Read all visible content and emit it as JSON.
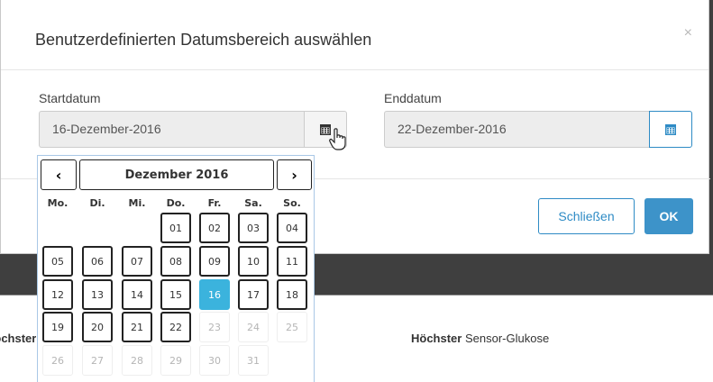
{
  "modal": {
    "title": "Benutzerdefinierten Datumsbereich auswählen",
    "close": "×",
    "start_label": "Startdatum",
    "start_value": "16-Dezember-2016",
    "end_label": "Enddatum",
    "end_value": "22-Dezember-2016",
    "close_button": "Schließen",
    "ok_button": "OK"
  },
  "datepicker": {
    "prev": "‹",
    "month": "Dezember 2016",
    "next": "›",
    "weekdays": [
      "Mo.",
      "Di.",
      "Mi.",
      "Do.",
      "Fr.",
      "Sa.",
      "So."
    ],
    "selected": "16",
    "rows": [
      [
        "",
        "",
        "",
        "01",
        "02",
        "03",
        "04"
      ],
      [
        "05",
        "06",
        "07",
        "08",
        "09",
        "10",
        "11"
      ],
      [
        "12",
        "13",
        "14",
        "15",
        "16",
        "17",
        "18"
      ],
      [
        "19",
        "20",
        "21",
        "22",
        "23",
        "24",
        "25"
      ],
      [
        "26",
        "27",
        "28",
        "29",
        "30",
        "31",
        ""
      ]
    ],
    "disabled_from_row3_col": 4
  },
  "background": {
    "left_text": "Höchster",
    "right_bold": "Höchster",
    "right_text": " Sensor-Glukose"
  },
  "icons": [
    "calendar-icon",
    "hand-pointer-icon",
    "close-icon"
  ],
  "colors": {
    "accent": "#2e8bc5",
    "selected_day": "#3bb3dd",
    "ok": "#3d93c9"
  }
}
